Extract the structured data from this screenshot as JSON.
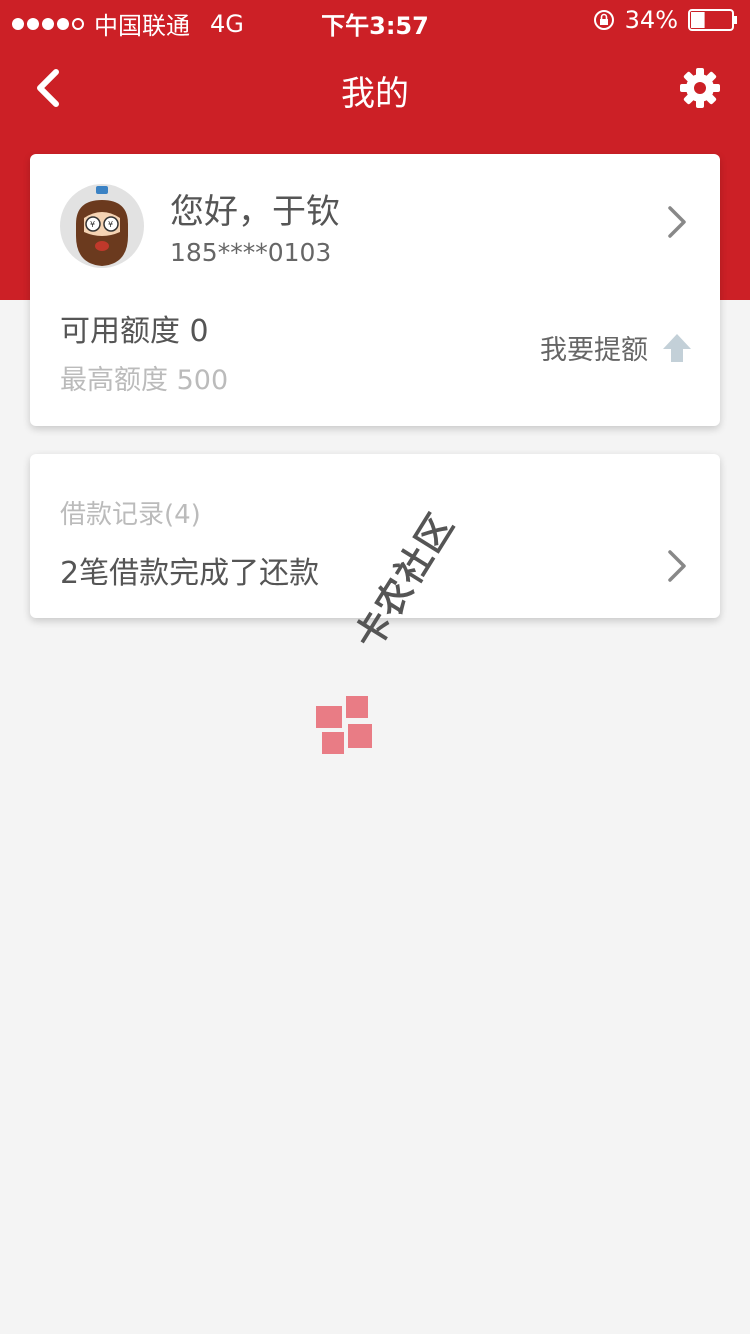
{
  "status_bar": {
    "carrier": "中国联通",
    "network": "4G",
    "time": "下午3:57",
    "battery": "34%",
    "battery_level": 0.34
  },
  "nav": {
    "title": "我的",
    "back_icon": "chevron-left-icon",
    "settings_icon": "gear-icon"
  },
  "profile": {
    "greeting": "您好，于钦",
    "phone": "185****0103",
    "available_credit": "可用额度 0",
    "max_credit": "最高额度 500",
    "raise_limit": "我要提额"
  },
  "loans": {
    "header": "借款记录(4)",
    "summary": "2笔借款完成了还款"
  },
  "watermark": {
    "text": "卡农社区"
  },
  "colors": {
    "brand_red": "#cc2026",
    "background": "#f4f4f4",
    "arrow_gray": "#c3d0d8"
  }
}
